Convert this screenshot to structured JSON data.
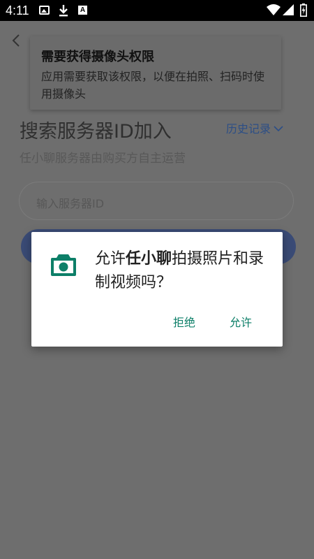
{
  "status_bar": {
    "time": "4:11",
    "icons": [
      "image-icon",
      "download-icon",
      "a-badge-icon",
      "wifi-icon",
      "signal-icon",
      "battery-charging-icon"
    ]
  },
  "page": {
    "heading": "搜索服务器ID加入",
    "history_label": "历史记录",
    "subtitle": "任小聊服务器由购买方自主运营",
    "server_input_placeholder": "输入服务器ID"
  },
  "toast": {
    "title": "需要获得摄像头权限",
    "body": "应用需要获取该权限，以便在拍照、扫码时使用摄像头"
  },
  "dialog": {
    "prefix": "允许",
    "app_name": "任小聊",
    "suffix": "拍摄照片和录制视频吗？",
    "deny_label": "拒绝",
    "allow_label": "允许",
    "accent_color": "#0d7f68"
  }
}
